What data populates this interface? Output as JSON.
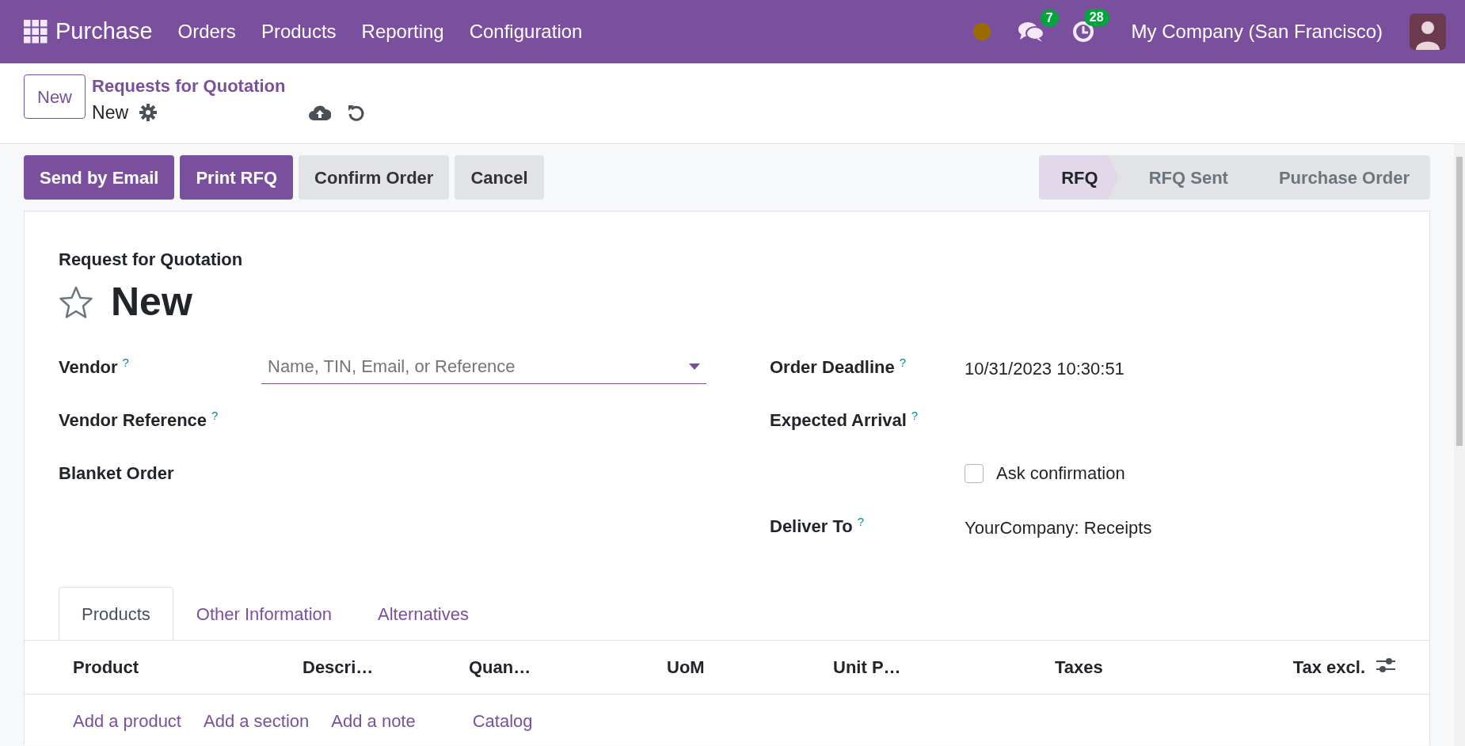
{
  "navbar": {
    "app_name": "Purchase",
    "menu": [
      "Orders",
      "Products",
      "Reporting",
      "Configuration"
    ],
    "messages_count": "7",
    "activities_count": "28",
    "company": "My Company (San Francisco)"
  },
  "control_panel": {
    "new_button": "New",
    "breadcrumb": "Requests for Quotation",
    "record_name": "New"
  },
  "action_buttons": [
    {
      "label": "Send by Email",
      "kind": "primary"
    },
    {
      "label": "Print RFQ",
      "kind": "primary"
    },
    {
      "label": "Confirm Order",
      "kind": "secondary"
    },
    {
      "label": "Cancel",
      "kind": "secondary"
    }
  ],
  "statusbar": [
    {
      "label": "RFQ",
      "selected": true
    },
    {
      "label": "RFQ Sent",
      "selected": false
    },
    {
      "label": "Purchase Order",
      "selected": false
    }
  ],
  "form": {
    "subtitle": "Request for Quotation",
    "title": "New",
    "starred": false,
    "left_fields": [
      {
        "kind": "select",
        "label": "Vendor",
        "help": "?",
        "placeholder": "Name, TIN, Email, or Reference"
      },
      {
        "kind": "text",
        "label": "Vendor Reference",
        "help": "?"
      },
      {
        "kind": "text",
        "label": "Blanket Order"
      }
    ],
    "right_fields": [
      {
        "kind": "text",
        "label": "Order Deadline",
        "help": "?",
        "value": "10/31/2023 10:30:51"
      },
      {
        "kind": "text",
        "label": "Expected Arrival",
        "help": "?"
      },
      {
        "kind": "checkbox",
        "label": "Ask confirmation",
        "checked": false
      },
      {
        "kind": "text",
        "label": "Deliver To",
        "help": "?",
        "value": "YourCompany: Receipts"
      }
    ]
  },
  "tabs": [
    {
      "label": "Products",
      "selected": true
    },
    {
      "label": "Other Information",
      "selected": false
    },
    {
      "label": "Alternatives",
      "selected": false
    }
  ],
  "table": {
    "columns": [
      "Product",
      "Descri…",
      "Quan…",
      "UoM",
      "Unit P…",
      "Taxes",
      "Tax excl."
    ],
    "add_links": [
      "Add a product",
      "Add a section",
      "Add a note",
      "Catalog"
    ]
  }
}
